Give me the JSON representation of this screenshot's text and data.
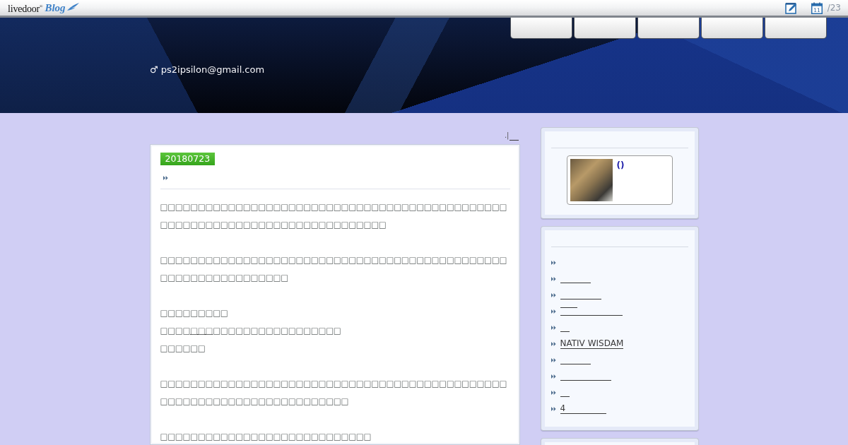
{
  "top_bar": {
    "logo": {
      "wordmark": "livedoor$^{®}$",
      "product": "Blog"
    },
    "calendar_day": "11",
    "date_fragment": "/23"
  },
  "header": {
    "nav_tabs": [
      {
        "kind": "blank"
      },
      {
        "kind": "blank"
      },
      {
        "kind": "blank"
      },
      {
        "kind": "blank"
      },
      {
        "kind": "blank"
      }
    ],
    "author": "♂ ps2ipsilon@gmail.com"
  },
  "post_nav": {
    "separator": ".|",
    "links": [
      {
        "kind": "blank"
      }
    ]
  },
  "post": {
    "date": "20180723",
    "body": [
      {
        "kind": "paragraph",
        "text": "□□□□□□□□□□□□□□□□□□□□□□□□□□□□□□□□□□□□□□□□□□□□□□□□□□□□□□□□□□□□□□□□□□□□□□□□□□□□"
      },
      {
        "kind": "paragraph",
        "text": "□□□□□□□□□□□□□□□□□□□□□□□□□□□□□□□□□□□□□□□□□□□□□□□□□□□□□□□□□□□□□□□"
      },
      {
        "kind": "lines",
        "lines": [
          {
            "text": "□□□□□□□□□"
          },
          {
            "text": "□□□□",
            "link": "□□□",
            "after": "□□□□□□□□□□□□□□□□□"
          },
          {
            "text": "□□□□□□"
          }
        ]
      },
      {
        "kind": "paragraph",
        "text": "□□□□□□□□□□□□□□□□□□□□□□□□□□□□□□□□□□□□□□□□□□□□□□□□□□□□□□□□□□□□□□□□□□□□□□□"
      },
      {
        "kind": "paragraph",
        "text": "□□□□□□□□□□□□□□□□□□□□□□□□□□□□"
      }
    ]
  },
  "sidebar": {
    "widgets": [
      {
        "kind": "profile",
        "name": "()"
      },
      {
        "kind": "links",
        "items": [
          {
            "kind": "empty"
          },
          {
            "kind": "blank"
          },
          {
            "kind": "blank"
          },
          {
            "kind": "blank"
          },
          {
            "kind": "blank"
          },
          {
            "kind": "text",
            "label": "NATIV WISDAM"
          },
          {
            "kind": "blank"
          },
          {
            "kind": "blank"
          },
          {
            "kind": "blank"
          },
          {
            "kind": "text",
            "label": "4"
          }
        ]
      },
      {
        "kind": "empty"
      }
    ]
  }
}
